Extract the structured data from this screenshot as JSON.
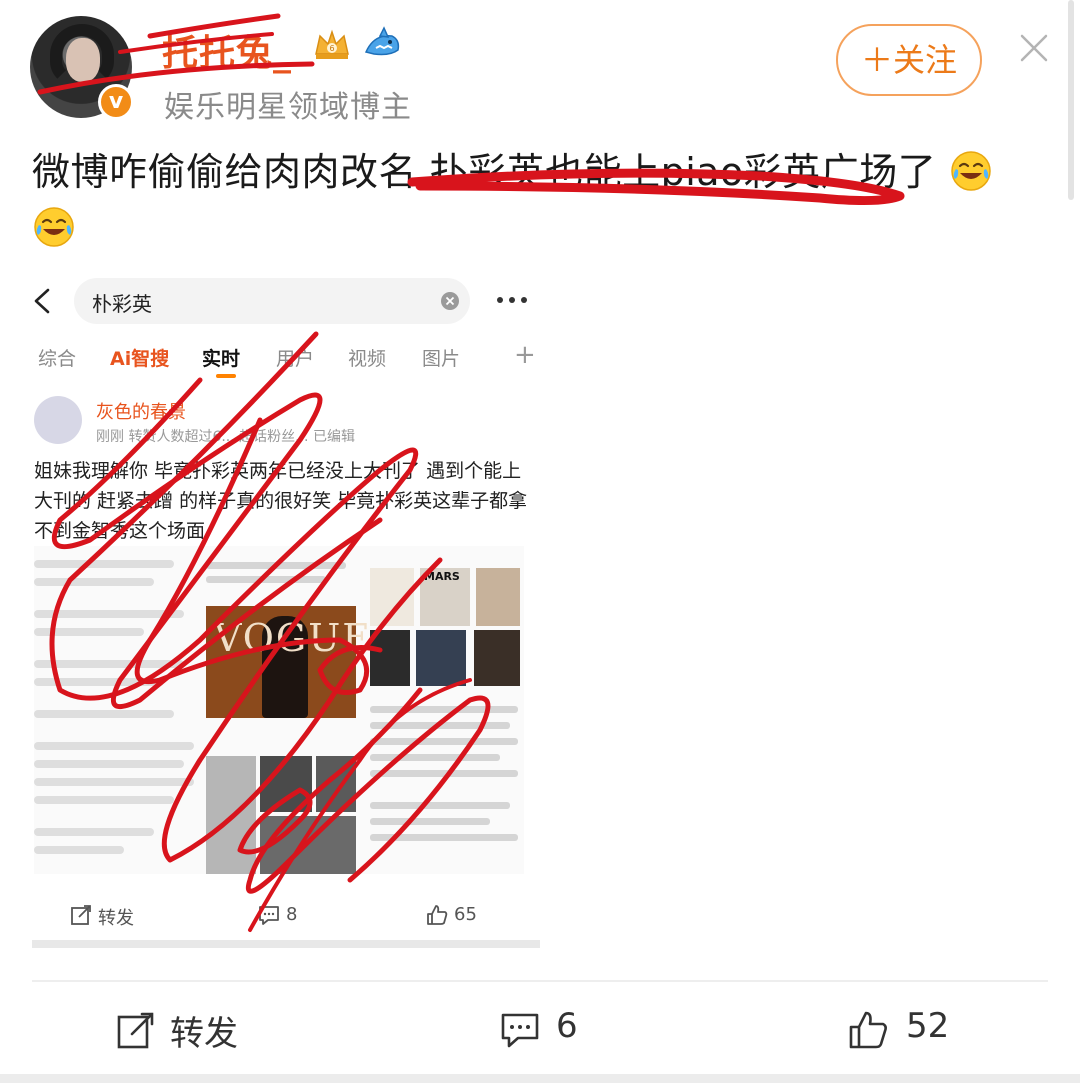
{
  "author": {
    "name": "托托兔_",
    "subtitle": "娱乐明星领域博主",
    "verified_mark": "v",
    "badges": [
      "crown-badge-icon",
      "shark-badge-icon"
    ],
    "name_color": "#e8541e"
  },
  "header": {
    "follow_label": "＋关注",
    "close_icon": "close-icon"
  },
  "post": {
    "text_main": "微博咋偷偷给肉肉改名 扑彩英也能上piao彩英广场了",
    "emoji": "laughing-crying-emoji"
  },
  "embedded_screenshot": {
    "search_query": "朴彩英",
    "tabs": [
      "综合",
      "Ai智搜",
      "实时",
      "用户",
      "视频",
      "图片"
    ],
    "active_tab": "实时",
    "inner_post": {
      "author": "灰色的春景",
      "meta": "刚刚  转赞人数超过6...  超话粉丝...  已编辑",
      "text": "姐妹我理解你 毕竟扑彩英两年已经没上大刊了 遇到个能上大刊的 赶紧去蹭 的样子真的很好笑 毕竟扑彩英这辈子都拿不到金智秀这个场面",
      "magazine_title": "VOGUE",
      "magazine_title_2": "MARS"
    },
    "actions": {
      "repost_label": "转发",
      "comment_count": "8",
      "like_count": "65"
    }
  },
  "action_bar": {
    "repost_label": "转发",
    "comment_count": "6",
    "like_count": "52"
  },
  "colors": {
    "accent_orange": "#ec7a19",
    "scribble_red": "#d8141c"
  }
}
